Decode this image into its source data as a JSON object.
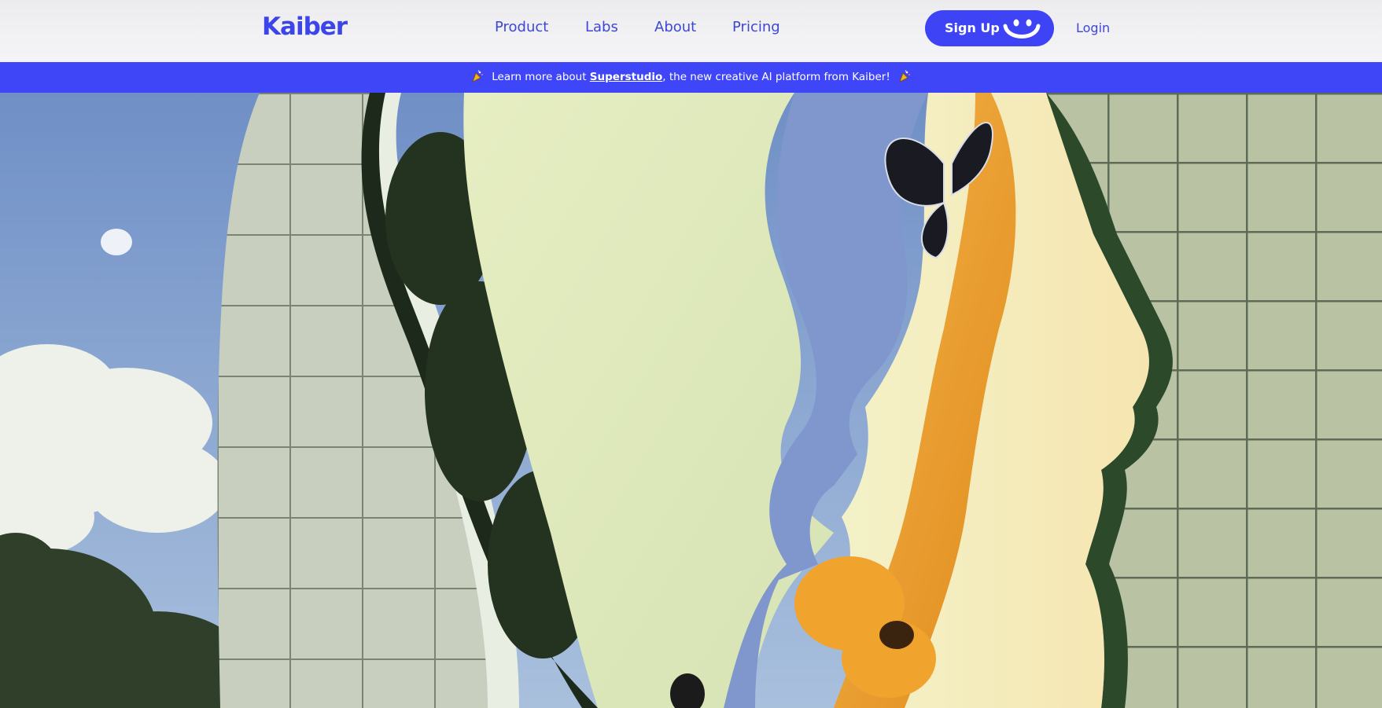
{
  "brand": {
    "logo_text": "Kaiber"
  },
  "nav": {
    "items": [
      {
        "label": "Product"
      },
      {
        "label": "Labs"
      },
      {
        "label": "About"
      },
      {
        "label": "Pricing"
      }
    ]
  },
  "actions": {
    "signup_label": "Sign Up",
    "signup_icon": "smile-icon",
    "login_label": "Login"
  },
  "banner": {
    "prefix": "Learn more about ",
    "link_text": "Superstudio",
    "suffix": ", the new creative AI platform from Kaiber!",
    "icon": "party-popper-icon"
  },
  "colors": {
    "brand_blue": "#3e43f5",
    "banner_blue": "#3f46f7",
    "nav_text": "#3d46d6"
  }
}
